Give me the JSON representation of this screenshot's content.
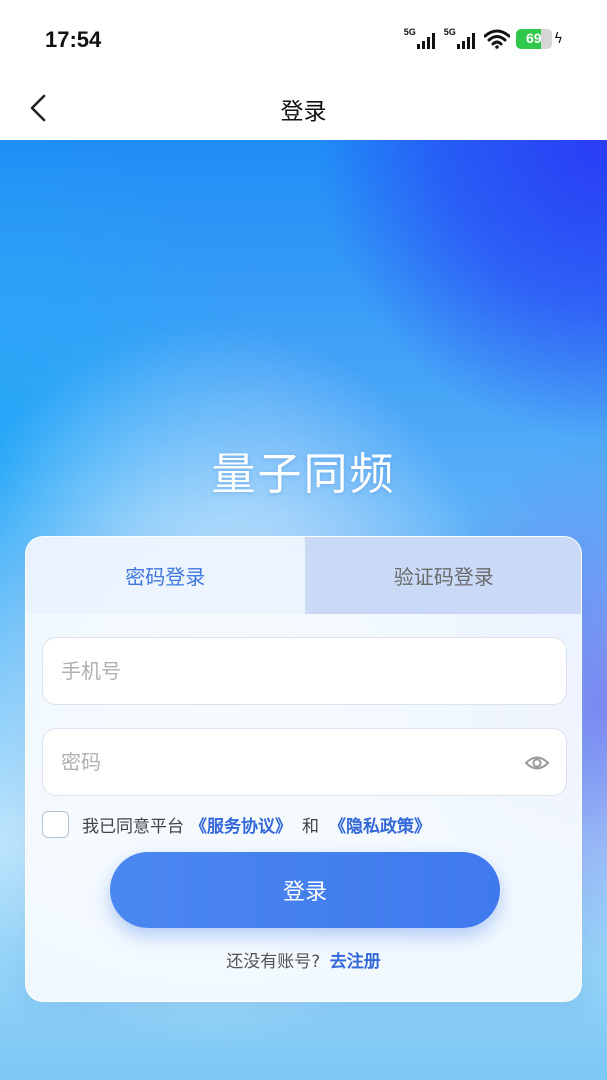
{
  "status_bar": {
    "time": "17:54",
    "network_1": "5G",
    "network_2": "5G",
    "battery_level": "69",
    "battery_color": "#2fc84a"
  },
  "nav": {
    "back_icon": "chevron-left-icon",
    "title": "登录"
  },
  "app_title": "量子同频",
  "tabs": [
    {
      "label": "密码登录",
      "active": true
    },
    {
      "label": "验证码登录",
      "active": false
    }
  ],
  "form": {
    "phone_placeholder": "手机号",
    "password_placeholder": "密码",
    "eye_icon": "eye-icon"
  },
  "agreement": {
    "prefix": "我已同意平台",
    "service_link": "《服务协议》",
    "and": "和",
    "privacy_link": "《隐私政策》",
    "checked": false
  },
  "login_button": "登录",
  "register": {
    "question": "还没有账号?",
    "link": "去注册"
  },
  "colors": {
    "accent": "#3f79ee",
    "link": "#3468d8"
  }
}
